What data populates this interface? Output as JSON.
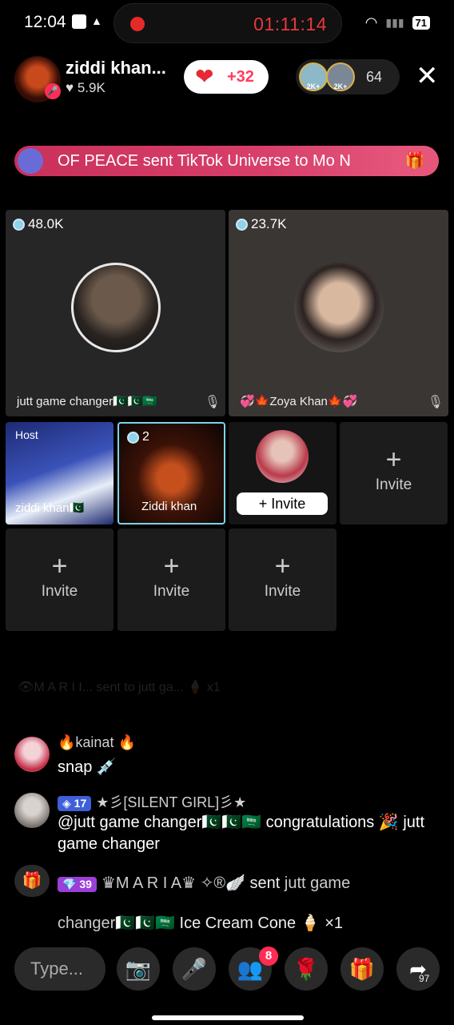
{
  "status_bar": {
    "time": "12:04",
    "record_time": "01:11:14",
    "battery": "71"
  },
  "host": {
    "name": "ziddi khan...",
    "likes": "♥ 5.9K"
  },
  "likes_pill": {
    "count": "+32"
  },
  "viewers": {
    "badge1": "2K+",
    "badge2": "2K+",
    "count": "64"
  },
  "banner": {
    "text": "OF PEACE sent TikTok Universe to Mo N"
  },
  "tiles": {
    "guest1": {
      "coins": "48.0K",
      "name": "jutt game changer🇵🇰🇵🇰🇸🇦"
    },
    "guest2": {
      "coins": "23.7K",
      "name": "💞🍁Zoya Khan🍁💞"
    },
    "host_tile": {
      "tag": "Host",
      "name": "ziddi khan🇵🇰"
    },
    "me_tile": {
      "count": "2",
      "name": "Ziddi khan"
    },
    "request_tile": {
      "button": "+ Invite"
    },
    "invite_label": "Invite"
  },
  "chat": {
    "faded": "👁M A R I I...  sent to jutt ga...  🍦  x1",
    "messages": [
      {
        "name": "🔥kainat 🔥",
        "text": "snap 💉"
      },
      {
        "level": "17",
        "name": "★彡[SILENT GIRL]彡★",
        "text": "@jutt game changer🇵🇰🇵🇰🇸🇦 congratulations 🎉 jutt game changer"
      }
    ],
    "gift_event": {
      "level": "39",
      "sender": "♛M A R I A♛ ✧®🪽",
      "action": "sent",
      "target": "jutt game",
      "line2_target": "changer🇵🇰🇵🇰🇸🇦",
      "gift": "Ice Cream Cone 🍦",
      "qty": "×1"
    }
  },
  "bottom_bar": {
    "type_placeholder": "Type...",
    "guests_badge": "8",
    "share_count": "97"
  }
}
